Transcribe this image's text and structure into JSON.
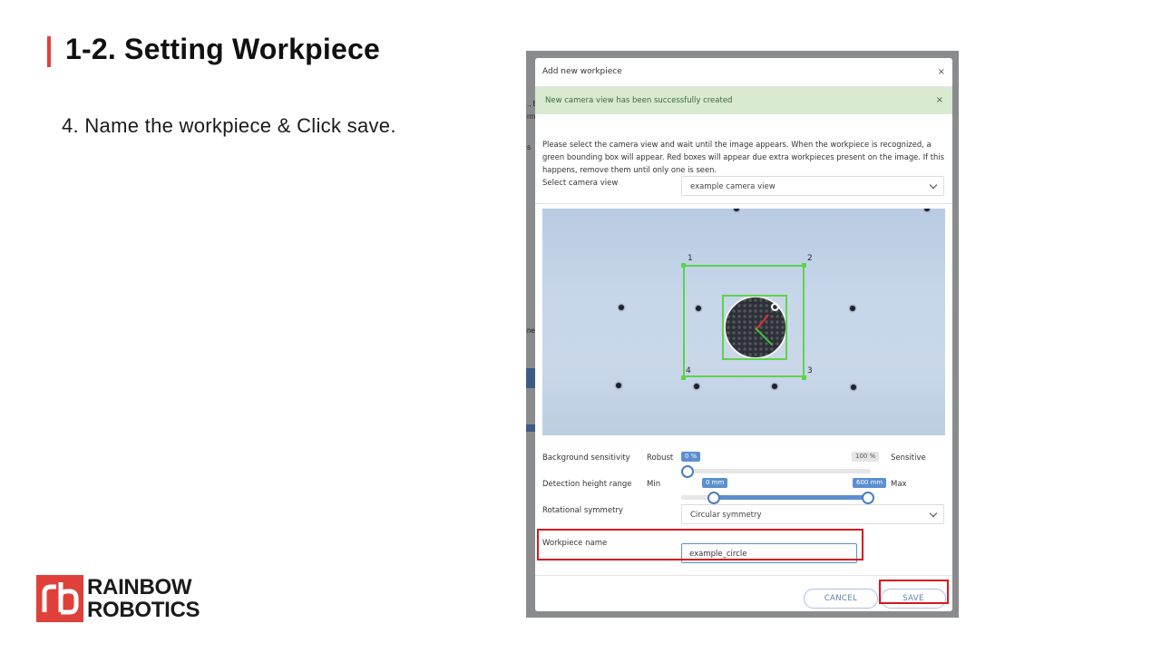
{
  "slide": {
    "title": "1-2. Setting Workpiece",
    "instruction": "4. Name the workpiece & Click save."
  },
  "logo": {
    "line1": "RAINBOW",
    "line2": "ROBOTICS",
    "mark": "rb"
  },
  "background": {
    "fragments": [
      "., E",
      "rm",
      "s",
      "ne"
    ]
  },
  "modal": {
    "title": "Add new workpiece",
    "close_icon": "×",
    "alert": {
      "text": "New camera view has been successfully created",
      "close_icon": "×"
    },
    "description": "Please select the camera view and wait until the image appears. When the workpiece is recognized, a green bounding box will appear. Red boxes will appear due extra workpieces present on the image. If this happens, remove them until only one is seen.",
    "camera_view": {
      "label": "Select camera view",
      "value": "example camera view"
    },
    "corners": [
      "1",
      "2",
      "3",
      "4"
    ],
    "background_sensitivity": {
      "label": "Background sensitivity",
      "left_label": "Robust",
      "right_label": "Sensitive",
      "value_chip": "0 %",
      "max_chip": "100 %",
      "value": 0
    },
    "detection_height": {
      "label": "Detection height range",
      "left_label": "Min",
      "right_label": "Max",
      "min_chip": "0 mm",
      "max_chip": "600 mm",
      "min_value": 0,
      "max_value": 600
    },
    "rotational_symmetry": {
      "label": "Rotational symmetry",
      "value": "Circular symmetry"
    },
    "workpiece_name": {
      "label": "Workpiece name",
      "value": "example_circle"
    },
    "buttons": {
      "cancel": "CANCEL",
      "save": "SAVE"
    }
  },
  "colors": {
    "accent_red": "#e0403a",
    "highlight_red": "#d7191f",
    "slider_blue": "#5b8fd0",
    "bbox_green": "#5fd34a",
    "alert_green_bg": "#d8ead2"
  }
}
